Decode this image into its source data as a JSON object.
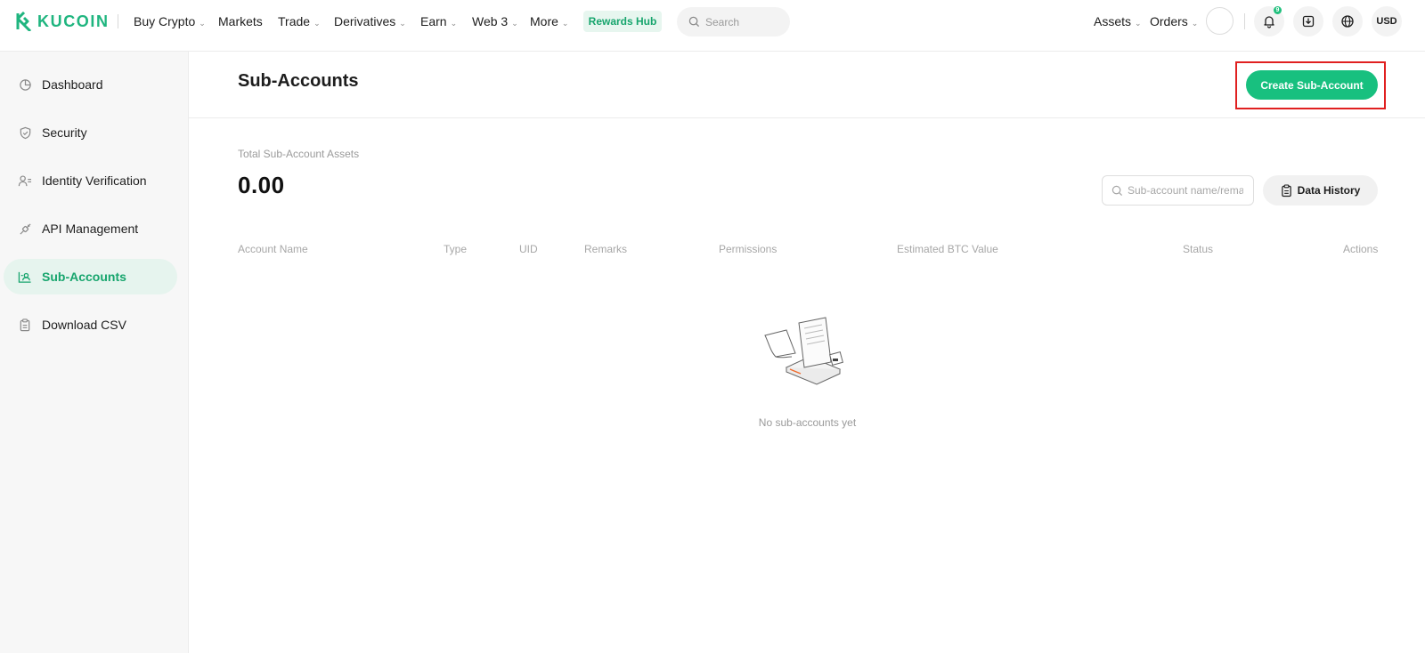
{
  "brand": {
    "name": "KUCOIN",
    "color": "#1fb57f"
  },
  "topnav": {
    "items": [
      {
        "label": "Buy Crypto",
        "caret": true
      },
      {
        "label": "Markets",
        "caret": false
      },
      {
        "label": "Trade",
        "caret": true
      },
      {
        "label": "Derivatives",
        "caret": true
      },
      {
        "label": "Earn",
        "caret": true
      },
      {
        "label": "Web 3",
        "caret": true
      },
      {
        "label": "More",
        "caret": true
      }
    ],
    "rewards_label": "Rewards Hub",
    "search_placeholder": "Search",
    "assets_label": "Assets",
    "orders_label": "Orders",
    "notification_count": "9",
    "currency": "USD",
    "icons": [
      "search-icon",
      "bell-icon",
      "download-icon",
      "globe-icon"
    ]
  },
  "sidebar": {
    "items": [
      {
        "label": "Dashboard",
        "icon": "pie-chart-icon",
        "active": false
      },
      {
        "label": "Security",
        "icon": "shield-icon",
        "active": false
      },
      {
        "label": "Identity Verification",
        "icon": "user-id-icon",
        "active": false
      },
      {
        "label": "API Management",
        "icon": "api-plug-icon",
        "active": false
      },
      {
        "label": "Sub-Accounts",
        "icon": "sub-accounts-icon",
        "active": true
      },
      {
        "label": "Download CSV",
        "icon": "clipboard-icon",
        "active": false
      }
    ],
    "active_color": "#17a56d"
  },
  "main": {
    "title": "Sub-Accounts",
    "create_button": "Create Sub-Account",
    "accent_color": "#18c07f",
    "total_assets_label": "Total Sub-Account Assets",
    "total_assets_value": "0.00",
    "filter_placeholder": "Sub-account name/remarks",
    "data_history_button": "Data History",
    "table": {
      "headers": [
        "Account Name",
        "Type",
        "UID",
        "Remarks",
        "Permissions",
        "Estimated BTC Value",
        "Status",
        "Actions"
      ],
      "rows": []
    },
    "empty_text": "No sub-accounts yet"
  }
}
